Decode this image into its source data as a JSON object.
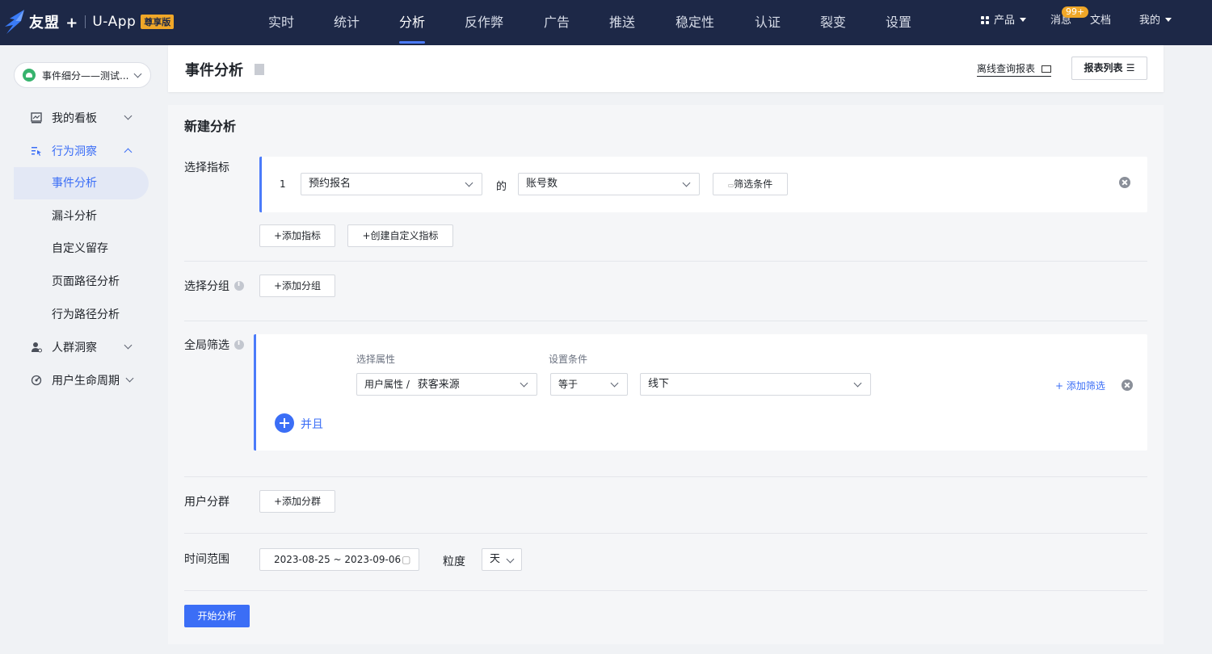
{
  "topbar": {
    "brand": "友盟 +",
    "app": "U-App",
    "edition_badge": "尊享版",
    "nav": [
      "实时",
      "统计",
      "分析",
      "反作弊",
      "广告",
      "推送",
      "稳定性",
      "认证",
      "裂变",
      "设置"
    ],
    "active_nav": "分析",
    "product_label": "产品",
    "messages_label": "消息",
    "messages_badge": "99+",
    "docs_label": "文档",
    "me_label": "我的"
  },
  "sidebar": {
    "app_selector": "事件细分——测试...",
    "items": [
      {
        "label": "我的看板",
        "icon": "chart-board-icon"
      },
      {
        "label": "行为洞察",
        "icon": "behavior-insight-icon"
      },
      {
        "label": "人群洞察",
        "icon": "people-insight-icon"
      },
      {
        "label": "用户生命周期",
        "icon": "lifecycle-icon"
      }
    ],
    "sub_items": [
      "事件分析",
      "漏斗分析",
      "自定义留存",
      "页面路径分析",
      "行为路径分析"
    ],
    "active_sub": "事件分析"
  },
  "header": {
    "title": "事件分析",
    "offline_report": "离线查询报表",
    "report_list": "报表列表"
  },
  "analysis": {
    "section_title": "新建分析",
    "metric": {
      "label": "选择指标",
      "index": "1",
      "event": "预约报名",
      "connector": "的",
      "measure": "账号数",
      "filter_button": "筛选条件",
      "add_metric": "+添加指标",
      "create_custom_metric": "+创建自定义指标"
    },
    "group": {
      "label": "选择分组",
      "add_group": "+添加分组"
    },
    "global_filter": {
      "label": "全局筛选",
      "attr_header": "选择属性",
      "cond_header": "设置条件",
      "attr_prefix": "用户属性 /",
      "attr_value": "获客来源",
      "operator": "等于",
      "value": "线下",
      "add_filter": "+ 添加筛选",
      "and_label": "并且"
    },
    "segment": {
      "label": "用户分群",
      "add_segment": "+添加分群"
    },
    "time": {
      "label": "时间范围",
      "range": "2023-08-25 ~ 2023-09-06",
      "granularity_label": "粒度",
      "granularity": "天"
    },
    "start_button": "开始分析"
  }
}
